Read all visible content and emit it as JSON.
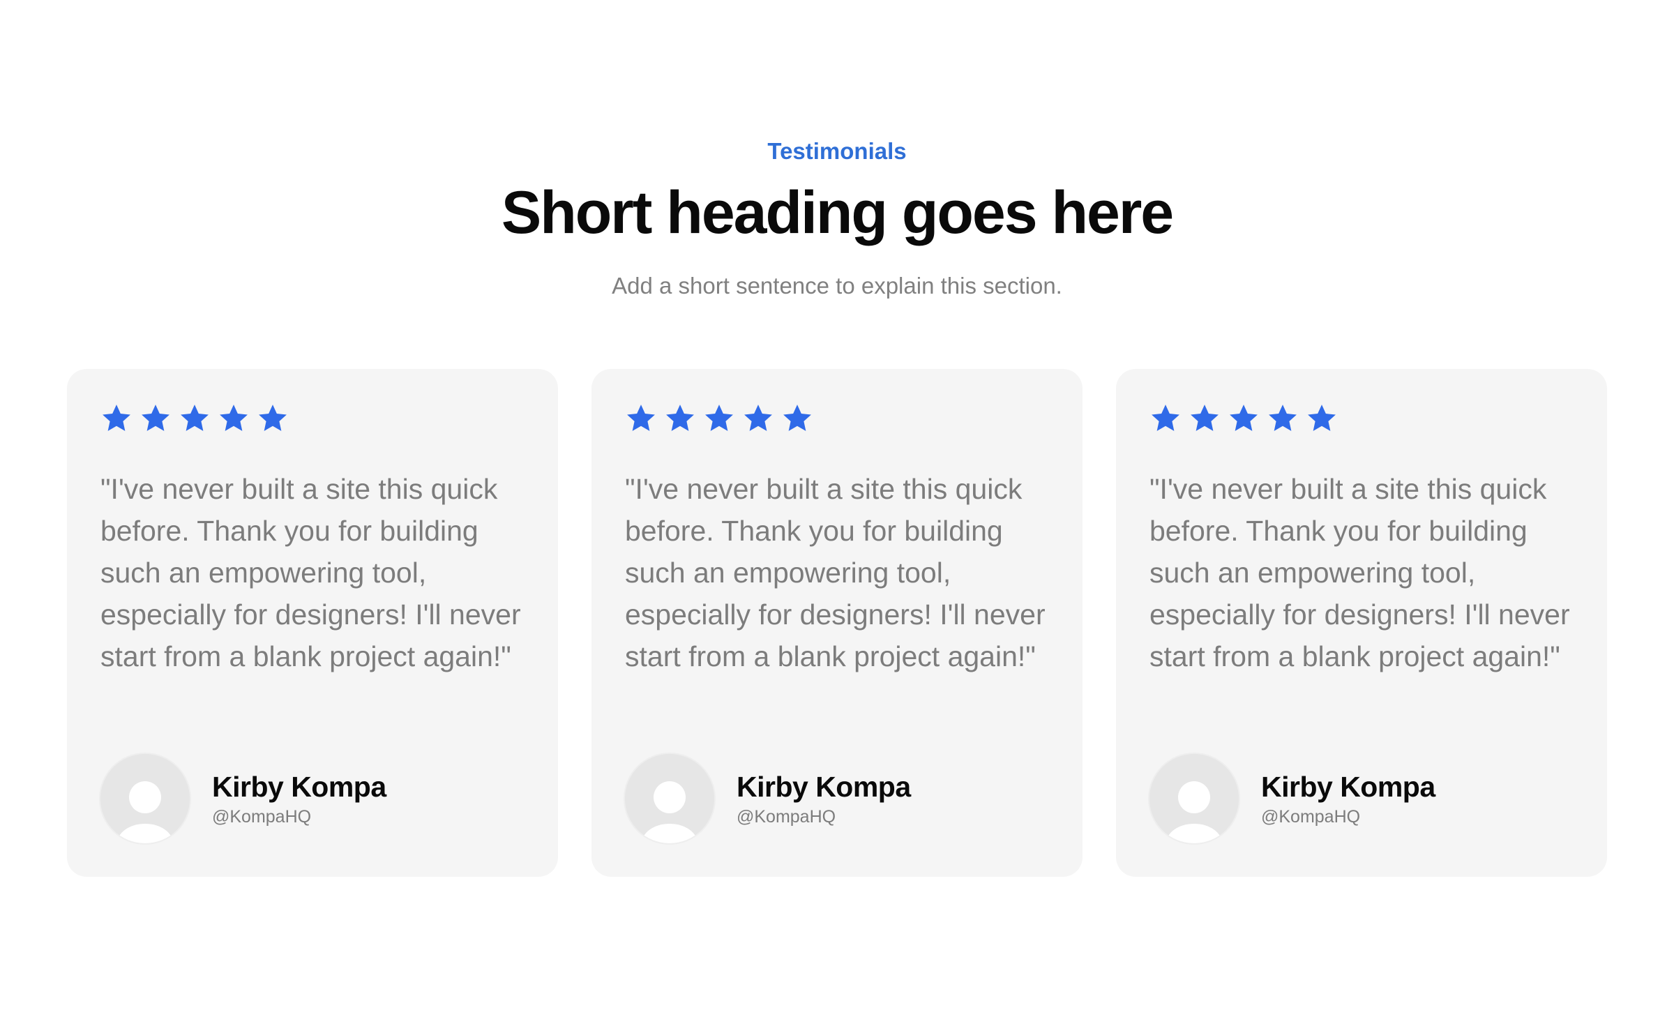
{
  "colors": {
    "accent": "#2f6fd6",
    "star": "#2f6ae8",
    "card_bg": "#f5f5f5",
    "avatar_bg": "#e6e6e6"
  },
  "header": {
    "eyebrow": "Testimonials",
    "title": "Short heading goes here",
    "subtitle": "Add a short sentence to explain this section."
  },
  "testimonials": [
    {
      "rating": 5,
      "rating_icon": "star-icon",
      "quote": "\"I've never built a site this quick before. Thank you for building such an empowering tool, especially for designers! I'll never start from a blank project again!\"",
      "avatar_icon": "user-avatar-placeholder",
      "name": "Kirby Kompa",
      "handle": "@KompaHQ"
    },
    {
      "rating": 5,
      "rating_icon": "star-icon",
      "quote": "\"I've never built a site this quick before. Thank you for building such an empowering tool, especially for designers! I'll never start from a blank project again!\"",
      "avatar_icon": "user-avatar-placeholder",
      "name": "Kirby Kompa",
      "handle": "@KompaHQ"
    },
    {
      "rating": 5,
      "rating_icon": "star-icon",
      "quote": "\"I've never built a site this quick before. Thank you for building such an empowering tool, especially for designers! I'll never start from a blank project again!\"",
      "avatar_icon": "user-avatar-placeholder",
      "name": "Kirby Kompa",
      "handle": "@KompaHQ"
    }
  ]
}
